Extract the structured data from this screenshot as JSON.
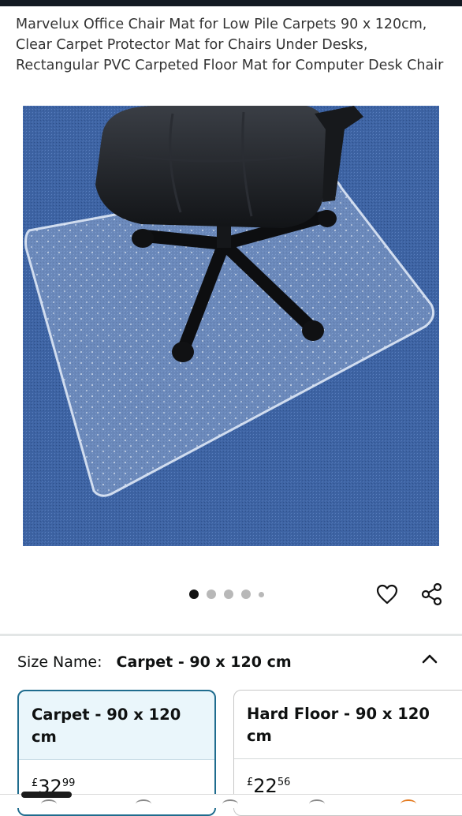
{
  "product": {
    "title": "Marvelux Office Chair Mat for Low Pile Carpets 90 x 120cm, Clear Carpet Protector Mat for Chairs Under Desks, Rectangular PVC Carpeted Floor Mat for Computer Desk Chair"
  },
  "gallery": {
    "dot_count": 5,
    "active_index": 0
  },
  "actions": {
    "wishlist_icon": "heart-icon",
    "share_icon": "share-icon"
  },
  "size_selector": {
    "label": "Size Name:",
    "selected_value": "Carpet - 90 x 120 cm",
    "expand_icon": "chevron-up-icon",
    "options": [
      {
        "name": "Carpet - 90 x 120 cm",
        "currency": "£",
        "price_whole": "32",
        "price_fraction": "99",
        "selected": true
      },
      {
        "name": "Hard Floor - 90 x 120 cm",
        "currency": "£",
        "price_whole": "22",
        "price_fraction": "56",
        "selected": false
      }
    ]
  },
  "colors": {
    "selected_border": "#1f6c8e",
    "selected_bg": "#eaf6fb",
    "carpet": "#3a5f9c"
  }
}
